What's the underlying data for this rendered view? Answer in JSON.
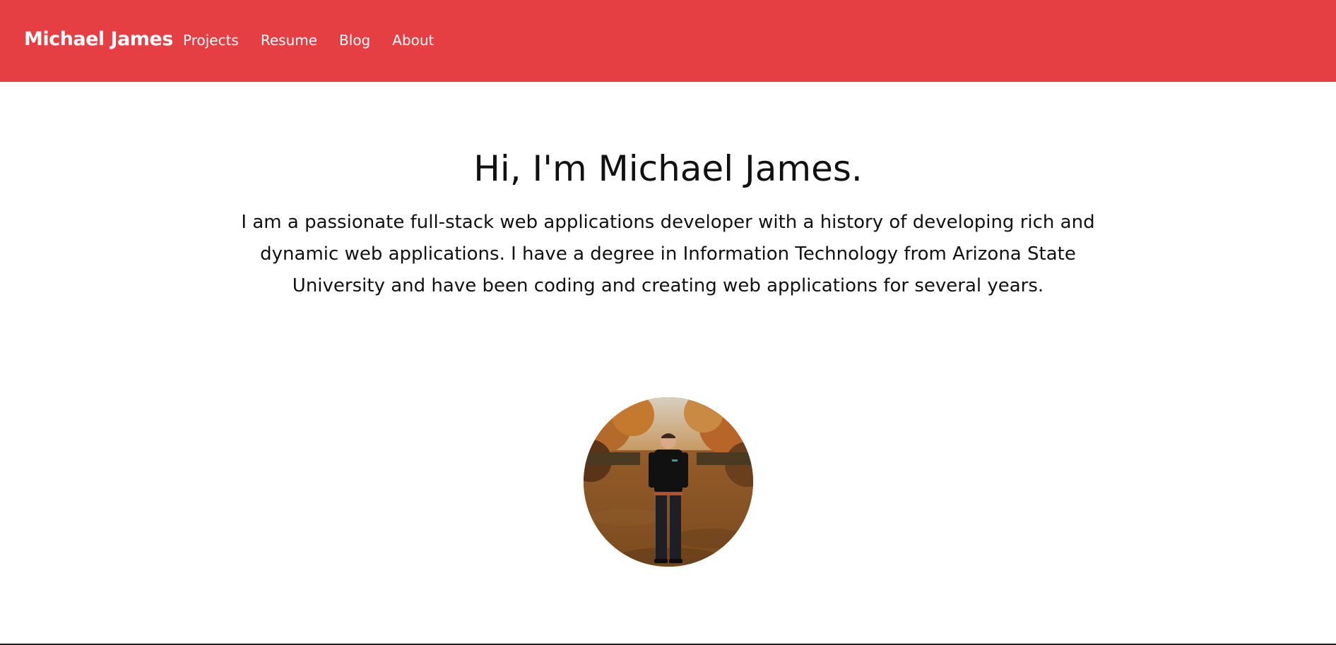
{
  "navbar": {
    "brand": "Michael James",
    "links": [
      {
        "label": "Projects"
      },
      {
        "label": "Resume"
      },
      {
        "label": "Blog"
      },
      {
        "label": "About"
      }
    ],
    "background_color": "#e53f43"
  },
  "hero": {
    "title": "Hi, I'm Michael James.",
    "intro": "I am a passionate full-stack web applications developer with a history of developing rich and dynamic web applications. I have a degree in Information Technology from Arizona State University and have been coding and creating web applications for several years."
  },
  "avatar": {
    "icon": "profile-photo"
  }
}
